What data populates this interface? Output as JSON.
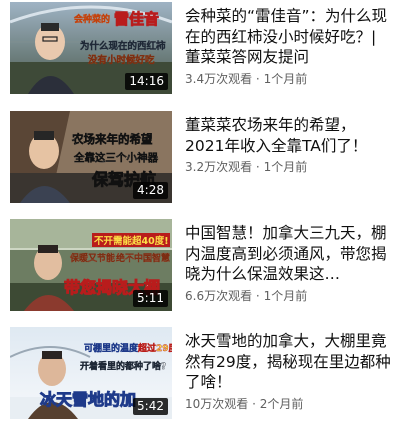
{
  "videos": [
    {
      "title": "会种菜的“雷佳音”：为什么现在的西红柿没小时候好吃？| 董菜菜答网友提问",
      "views": "3.4万次观看",
      "separator": "·",
      "age": "1个月前",
      "duration": "14:16",
      "thumb_text": {
        "line1": "会种菜的",
        "line1b": "雷佳音",
        "line2": "为什么现在的西红柿",
        "line3": "没有小时候好吃"
      }
    },
    {
      "title": "董菜菜农场来年的希望，2021年收入全靠TA们了！",
      "views": "3.2万次观看",
      "separator": "·",
      "age": "1个月前",
      "duration": "4:28",
      "thumb_text": {
        "line1": "农场来年的希望",
        "line2": "全靠这三个小神器",
        "line3": "保驾护航"
      }
    },
    {
      "title": "中国智慧！加拿大三九天，棚内温度高到必须通风，带您揭晓为什么保温效果这…",
      "views": "6.6万次观看",
      "separator": "·",
      "age": "1个月前",
      "duration": "5:11",
      "thumb_text": {
        "line1": "不开需能超40度!",
        "line2": "保暖又节能",
        "line2b": "绝不中国智慧",
        "line3": "带您揭晓大棚"
      }
    },
    {
      "title": "冰天雪地的加拿大，大棚里竟然有29度，揭秘现在里边都种了啥！",
      "views": "10万次观看",
      "separator": "·",
      "age": "2个月前",
      "duration": "5:42",
      "thumb_text": {
        "line1": "可棚里的温度",
        "line1b": "超过29度",
        "line2": "开着看里的都种了啥?",
        "line3": "冰天雪地的加"
      }
    }
  ]
}
